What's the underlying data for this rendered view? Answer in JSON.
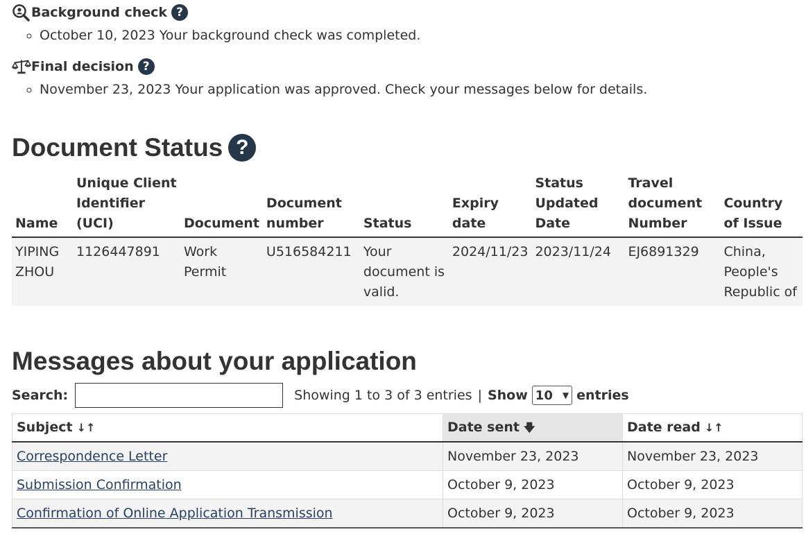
{
  "steps": [
    {
      "title": "Background check",
      "icon": "magnifier-person-icon",
      "items": [
        "October 10, 2023 Your background check was completed."
      ]
    },
    {
      "title": "Final decision",
      "icon": "scales-icon",
      "items": [
        "November 23, 2023 Your application was approved. Check your messages below for details."
      ]
    }
  ],
  "help_glyph": "?",
  "document_status": {
    "heading": "Document Status",
    "columns": [
      "Name",
      "Unique Client Identifier (UCI)",
      "Document",
      "Document number",
      "Status",
      "Expiry date",
      "Status Updated Date",
      "Travel document Number",
      "Country of Issue"
    ],
    "row": [
      "YIPING ZHOU",
      "1126447891",
      "Work Permit",
      "U516584211",
      "Your document is valid.",
      "2024/11/23",
      "2023/11/24",
      "EJ6891329",
      "China, People's Republic of"
    ]
  },
  "messages": {
    "heading": "Messages about your application",
    "search_label": "Search:",
    "search_value": "",
    "info": "Showing 1 to 3 of 3 entries",
    "separator": "|",
    "show_label": "Show",
    "page_size": "10",
    "entries_label": "entries",
    "columns": [
      "Subject",
      "Date sent",
      "Date read"
    ],
    "sorted_column": "Date sent",
    "rows": [
      [
        "Correspondence Letter",
        "November 23, 2023",
        "November 23, 2023"
      ],
      [
        "Submission Confirmation",
        "October 9, 2023",
        "October 9, 2023"
      ],
      [
        "Confirmation of Online Application Transmission",
        "October 9, 2023",
        "October 9, 2023"
      ]
    ]
  },
  "colors": {
    "help_bg": "#26374a",
    "link": "#284162",
    "row_alt": "#f3f3f3"
  }
}
